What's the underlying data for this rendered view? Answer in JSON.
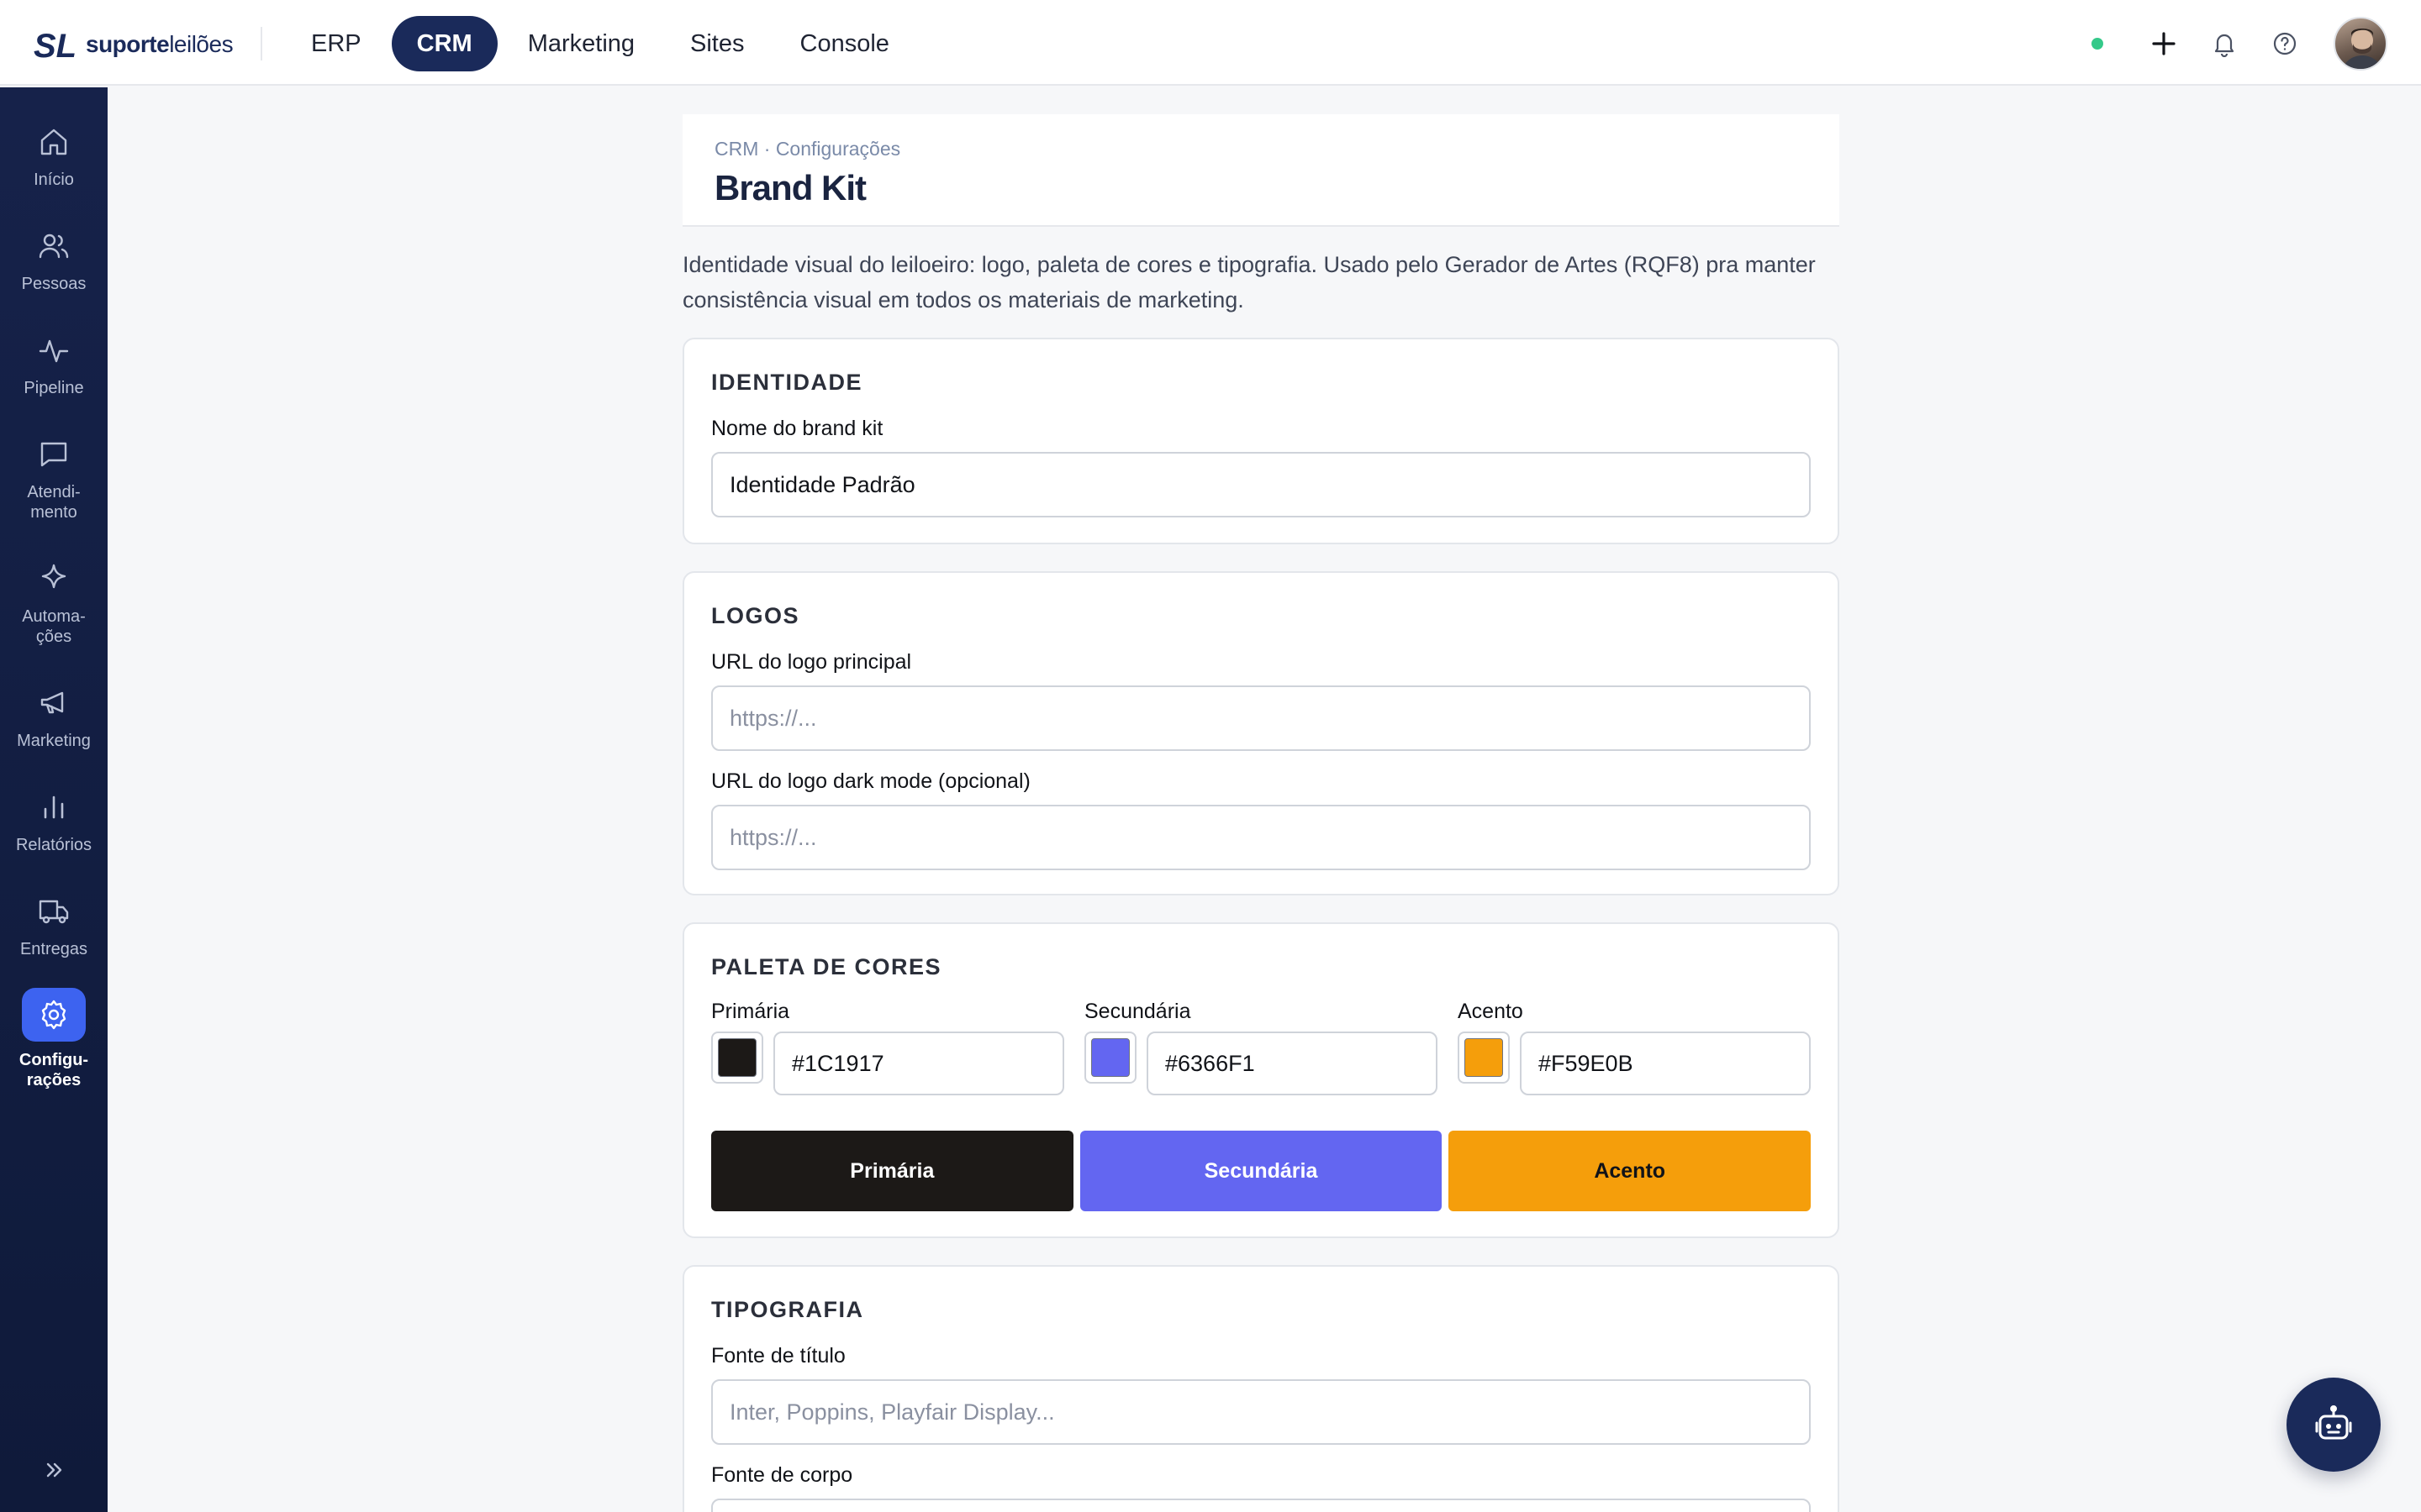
{
  "brand": {
    "mark": "SL",
    "name_bold": "suporte",
    "name_light": "leilões"
  },
  "topnav": [
    {
      "label": "ERP",
      "active": false
    },
    {
      "label": "CRM",
      "active": true
    },
    {
      "label": "Marketing",
      "active": false
    },
    {
      "label": "Sites",
      "active": false
    },
    {
      "label": "Console",
      "active": false
    }
  ],
  "top_actions": {
    "icons": [
      "plus-icon",
      "bell-icon",
      "help-icon"
    ],
    "status_color": "#34c989"
  },
  "sidebar": {
    "items": [
      {
        "icon": "home-icon",
        "label": "Início",
        "active": false
      },
      {
        "icon": "users-icon",
        "label": "Pessoas",
        "active": false
      },
      {
        "icon": "pipeline-icon",
        "label": "Pipeline",
        "active": false
      },
      {
        "icon": "chat-icon",
        "label": "Atendi-\nmento",
        "active": false
      },
      {
        "icon": "sparkle-icon",
        "label": "Automa-\nções",
        "active": false
      },
      {
        "icon": "megaphone-icon",
        "label": "Marketing",
        "active": false
      },
      {
        "icon": "bar-chart-icon",
        "label": "Relatórios",
        "active": false
      },
      {
        "icon": "truck-icon",
        "label": "Entregas",
        "active": false
      },
      {
        "icon": "gear-icon",
        "label": "Configu-\nrações",
        "active": true
      }
    ]
  },
  "header": {
    "breadcrumb": "CRM · Configurações",
    "title": "Brand Kit"
  },
  "intro": "Identidade visual do leiloeiro: logo, paleta de cores e tipografia. Usado pelo Gerador de Artes (RQF8) pra manter consistência visual em todos os materiais de marketing.",
  "identity": {
    "title": "IDENTIDADE",
    "name_label": "Nome do brand kit",
    "name_value": "Identidade Padrão"
  },
  "logos": {
    "title": "LOGOS",
    "main_label": "URL do logo principal",
    "main_placeholder": "https://...",
    "dark_label": "URL do logo dark mode (opcional)",
    "dark_placeholder": "https://..."
  },
  "palette": {
    "title": "PALETA DE CORES",
    "colors": [
      {
        "label": "Primária",
        "hex": "#1C1917",
        "text_color": "#ffffff"
      },
      {
        "label": "Secundária",
        "hex": "#6366F1",
        "text_color": "#ffffff"
      },
      {
        "label": "Acento",
        "hex": "#F59E0B",
        "text_color": "#111318"
      }
    ]
  },
  "typography": {
    "title": "TIPOGRAFIA",
    "title_font_label": "Fonte de título",
    "title_font_placeholder": "Inter, Poppins, Playfair Display...",
    "body_font_label": "Fonte de corpo"
  },
  "fab": {
    "icon": "robot-icon"
  }
}
